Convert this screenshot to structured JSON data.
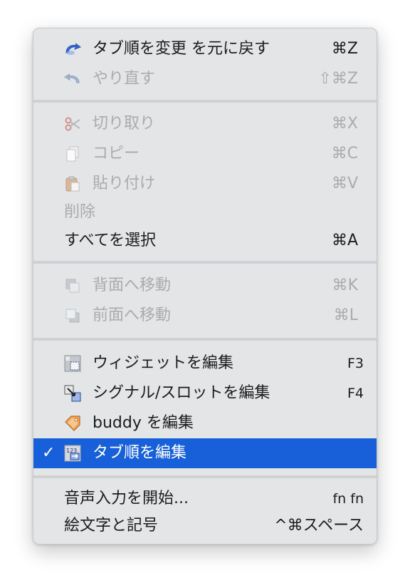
{
  "menu": {
    "items": [
      {
        "label": "タブ順を変更 を元に戻す",
        "shortcut": "⌘Z",
        "icon": "undo-icon",
        "disabled": false
      },
      {
        "label": "やり直す",
        "shortcut": "⇧⌘Z",
        "icon": "redo-icon",
        "disabled": true
      },
      {
        "label": "切り取り",
        "shortcut": "⌘X",
        "icon": "scissors-icon",
        "disabled": true
      },
      {
        "label": "コピー",
        "shortcut": "⌘C",
        "icon": "copy-icon",
        "disabled": true
      },
      {
        "label": "貼り付け",
        "shortcut": "⌘V",
        "icon": "paste-icon",
        "disabled": true
      },
      {
        "label": "削除",
        "shortcut": "",
        "icon": "",
        "disabled": true
      },
      {
        "label": "すべてを選択",
        "shortcut": "⌘A",
        "icon": "",
        "disabled": false
      },
      {
        "label": "背面へ移動",
        "shortcut": "⌘K",
        "icon": "send-to-back-icon",
        "disabled": true
      },
      {
        "label": "前面へ移動",
        "shortcut": "⌘L",
        "icon": "bring-to-front-icon",
        "disabled": true
      },
      {
        "label": "ウィジェットを編集",
        "shortcut": "F3",
        "icon": "edit-widgets-icon",
        "disabled": false
      },
      {
        "label": "シグナル/スロットを編集",
        "shortcut": "F4",
        "icon": "edit-signals-slots-icon",
        "disabled": false
      },
      {
        "label": "buddy を編集",
        "shortcut": "",
        "icon": "edit-buddies-icon",
        "disabled": false
      },
      {
        "label": "タブ順を編集",
        "shortcut": "",
        "icon": "edit-tab-order-icon",
        "disabled": false,
        "checked": true,
        "selected": true
      },
      {
        "label": "音声入力を開始...",
        "shortcut": "fn fn",
        "icon": "",
        "disabled": false
      },
      {
        "label": "絵文字と記号",
        "shortcut": "^⌘スペース",
        "icon": "",
        "disabled": false
      }
    ],
    "check_mark": "✓",
    "tab_order_icon_text": "123"
  },
  "colors": {
    "menu_bg": "#e3e5e7",
    "selection": "#1760d9",
    "disabled_text": "#a9abad"
  }
}
